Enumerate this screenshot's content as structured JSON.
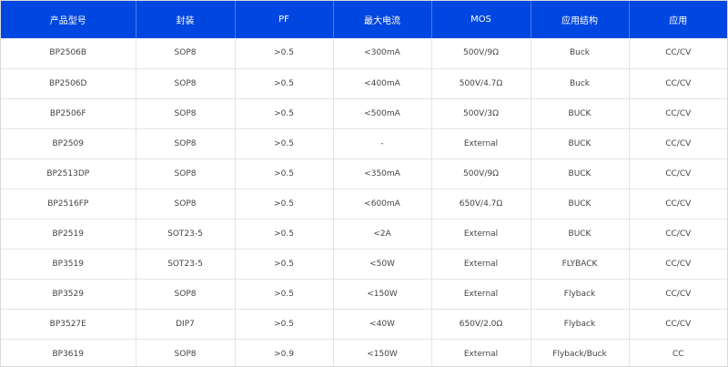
{
  "table": {
    "headers": [
      "产品型号",
      "封装",
      "PF",
      "最大电流",
      "MOS",
      "应用结构",
      "应用"
    ],
    "rows": [
      [
        "BP2506B",
        "SOP8",
        ">0.5",
        "<300mA",
        "500V/9Ω",
        "Buck",
        "CC/CV"
      ],
      [
        "BP2506D",
        "SOP8",
        ">0.5",
        "<400mA",
        "500V/4.7Ω",
        "Buck",
        "CC/CV"
      ],
      [
        "BP2506F",
        "SOP8",
        ">0.5",
        "<500mA",
        "500V/3Ω",
        "BUCK",
        "CC/CV"
      ],
      [
        "BP2509",
        "SOP8",
        ">0.5",
        "-",
        "External",
        "BUCK",
        "CC/CV"
      ],
      [
        "BP2513DP",
        "SOP8",
        ">0.5",
        "<350mA",
        "500V/9Ω",
        "BUCK",
        "CC/CV"
      ],
      [
        "BP2516FP",
        "SOP8",
        ">0.5",
        "<600mA",
        "650V/4.7Ω",
        "BUCK",
        "CC/CV"
      ],
      [
        "BP2519",
        "SOT23-5",
        ">0.5",
        "<2A",
        "External",
        "BUCK",
        "CC/CV"
      ],
      [
        "BP3519",
        "SOT23-5",
        ">0.5",
        "<50W",
        "External",
        "FLYBACK",
        "CC/CV"
      ],
      [
        "BP3529",
        "SOP8",
        ">0.5",
        "<150W",
        "External",
        "Flyback",
        "CC/CV"
      ],
      [
        "BP3527E",
        "DIP7",
        ">0.5",
        "<40W",
        "650V/2.0Ω",
        "Flyback",
        "CC/CV"
      ],
      [
        "BP3619",
        "SOP8",
        ">0.9",
        "<150W",
        "External",
        "Flyback/Buck",
        "CC"
      ]
    ]
  },
  "colors": {
    "header_bg": "#0046e0",
    "header_text": "#ffffff",
    "cell_text": "#444444",
    "grid_line": "#e4e4e4"
  }
}
